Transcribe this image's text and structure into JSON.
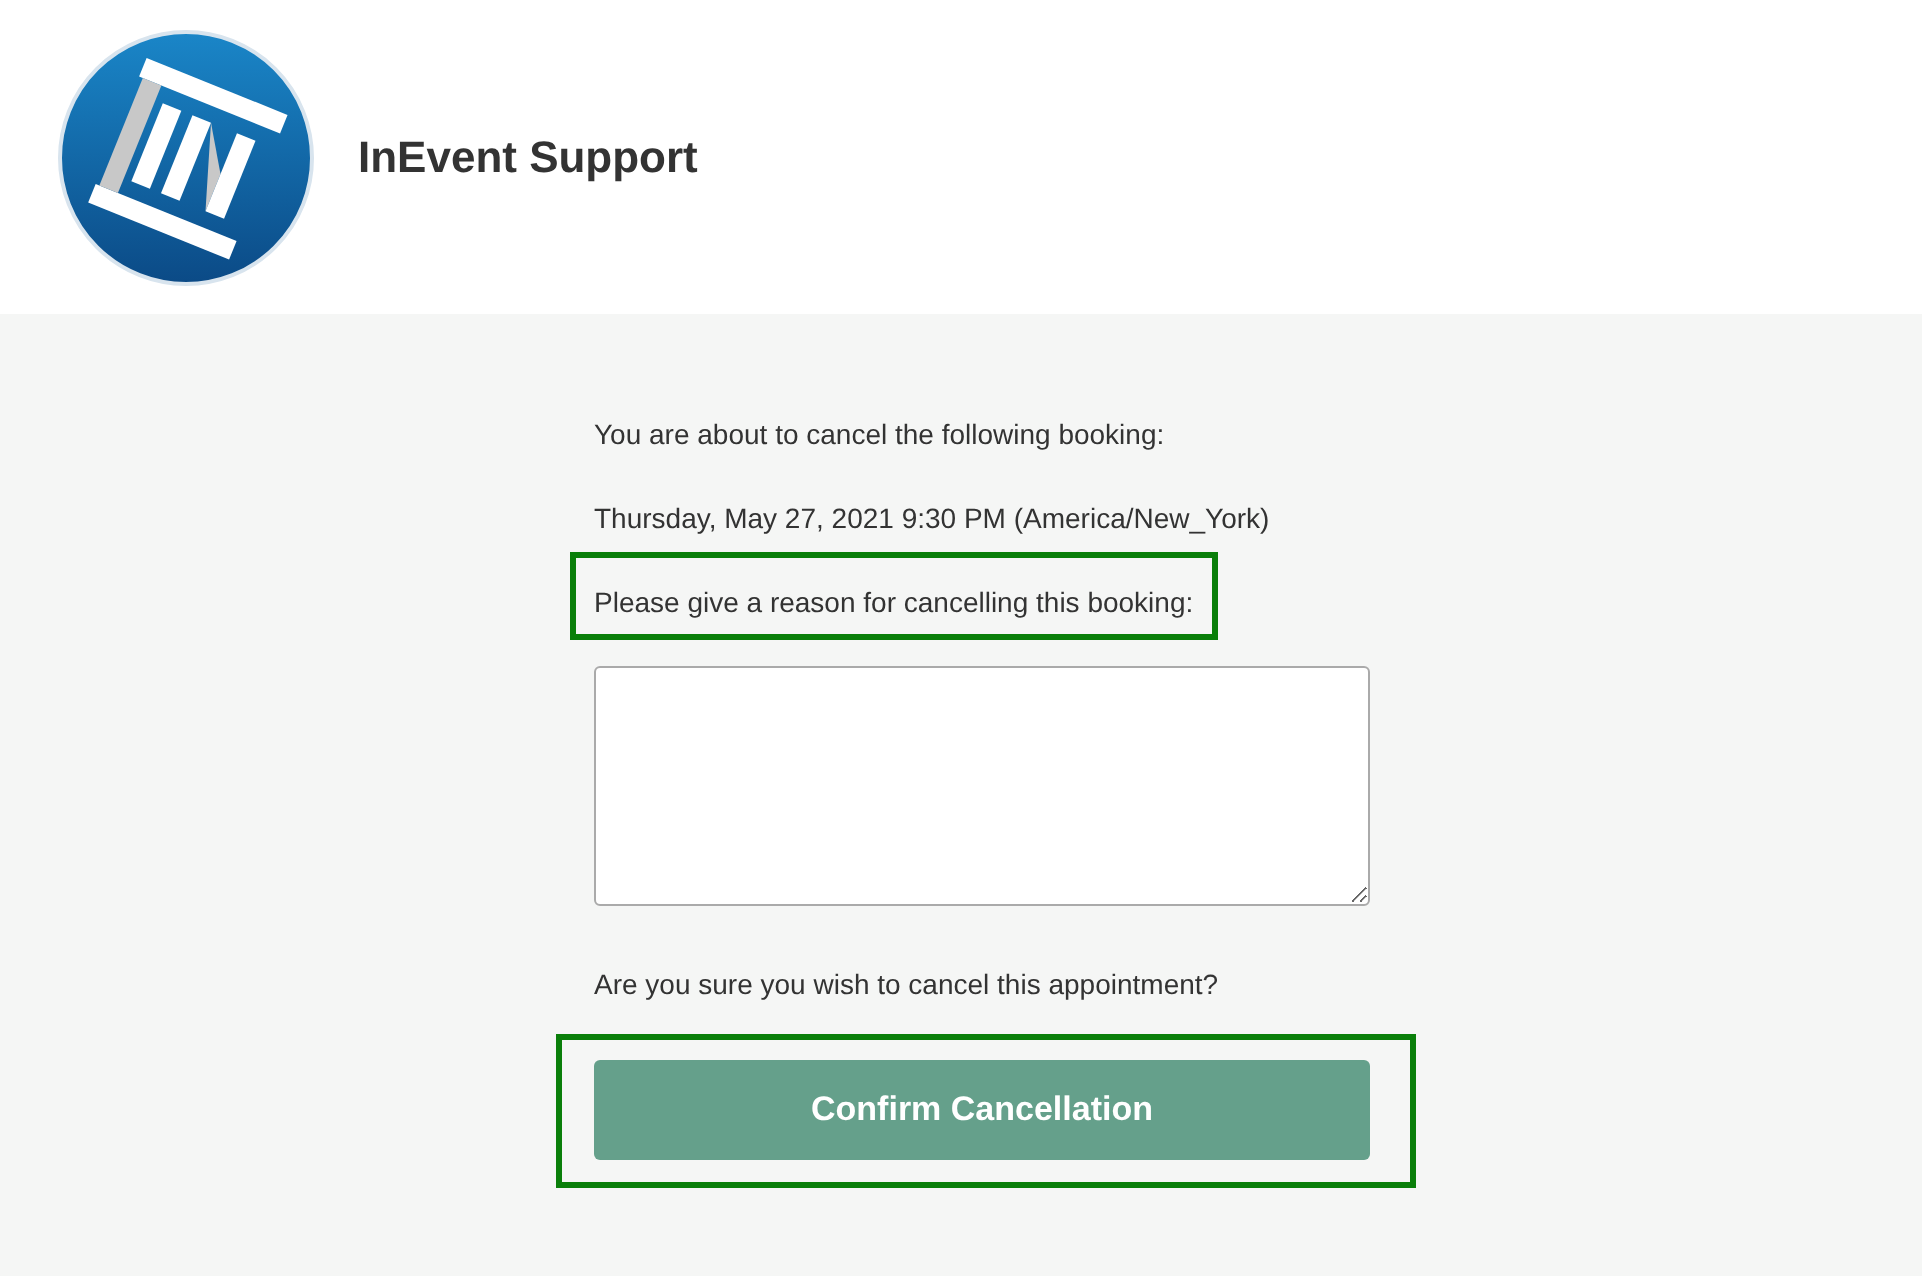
{
  "header": {
    "title": "InEvent Support"
  },
  "form": {
    "intro": "You are about to cancel the following booking:",
    "booking_time": "Thursday, May 27, 2021 9:30 PM (America/New_York)",
    "reason_label": {
      "text": "Please give a reason for cancelling this booking:",
      "highlighted": true
    },
    "question": "Are you sure you wish to cancel this appointment?",
    "confirm_button": {
      "label": "Confirm Cancellation",
      "highlighted": true
    }
  }
}
